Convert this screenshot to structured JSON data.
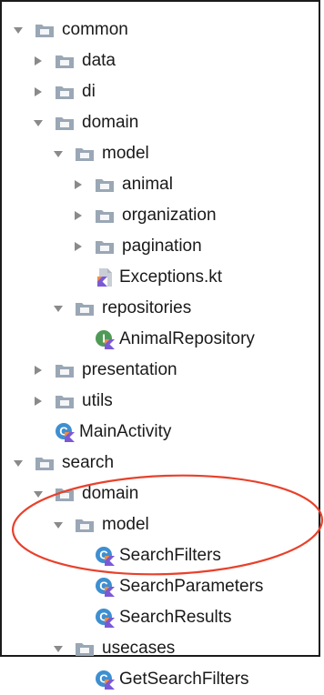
{
  "tree": [
    {
      "label": "common",
      "type": "folder",
      "depth": 0,
      "expanded": true
    },
    {
      "label": "data",
      "type": "folder",
      "depth": 1,
      "expanded": false
    },
    {
      "label": "di",
      "type": "folder",
      "depth": 1,
      "expanded": false
    },
    {
      "label": "domain",
      "type": "folder",
      "depth": 1,
      "expanded": true
    },
    {
      "label": "model",
      "type": "folder",
      "depth": 2,
      "expanded": true
    },
    {
      "label": "animal",
      "type": "folder",
      "depth": 3,
      "expanded": false
    },
    {
      "label": "organization",
      "type": "folder",
      "depth": 3,
      "expanded": false
    },
    {
      "label": "pagination",
      "type": "folder",
      "depth": 3,
      "expanded": false
    },
    {
      "label": "Exceptions.kt",
      "type": "kotlin-file",
      "depth": 3
    },
    {
      "label": "repositories",
      "type": "folder",
      "depth": 2,
      "expanded": true
    },
    {
      "label": "AnimalRepository",
      "type": "kotlin-interface",
      "depth": 3
    },
    {
      "label": "presentation",
      "type": "folder",
      "depth": 1,
      "expanded": false
    },
    {
      "label": "utils",
      "type": "folder",
      "depth": 1,
      "expanded": false
    },
    {
      "label": "MainActivity",
      "type": "kotlin-class",
      "depth": 1
    },
    {
      "label": "search",
      "type": "folder",
      "depth": 0,
      "expanded": true
    },
    {
      "label": "domain",
      "type": "folder",
      "depth": 1,
      "expanded": true
    },
    {
      "label": "model",
      "type": "folder",
      "depth": 2,
      "expanded": true
    },
    {
      "label": "SearchFilters",
      "type": "kotlin-class",
      "depth": 3
    },
    {
      "label": "SearchParameters",
      "type": "kotlin-class",
      "depth": 3
    },
    {
      "label": "SearchResults",
      "type": "kotlin-class",
      "depth": 3
    },
    {
      "label": "usecases",
      "type": "folder",
      "depth": 2,
      "expanded": true
    },
    {
      "label": "GetSearchFilters",
      "type": "kotlin-class",
      "depth": 3
    }
  ],
  "colors": {
    "arrow": "#8a8a8a",
    "folder": "#9aa7b5",
    "class_icon": "#3d8fd1",
    "interface_icon": "#4f9a57",
    "kotlin_orange": "#f08d3c",
    "kotlin_purple": "#7b59d6",
    "highlight": "#e8412b"
  },
  "icons": {
    "folder": "folder-icon",
    "expanded": "chevron-down-icon",
    "collapsed": "chevron-right-icon",
    "kotlin-class": "kotlin-class-icon",
    "kotlin-interface": "kotlin-interface-icon",
    "kotlin-file": "kotlin-file-icon"
  }
}
